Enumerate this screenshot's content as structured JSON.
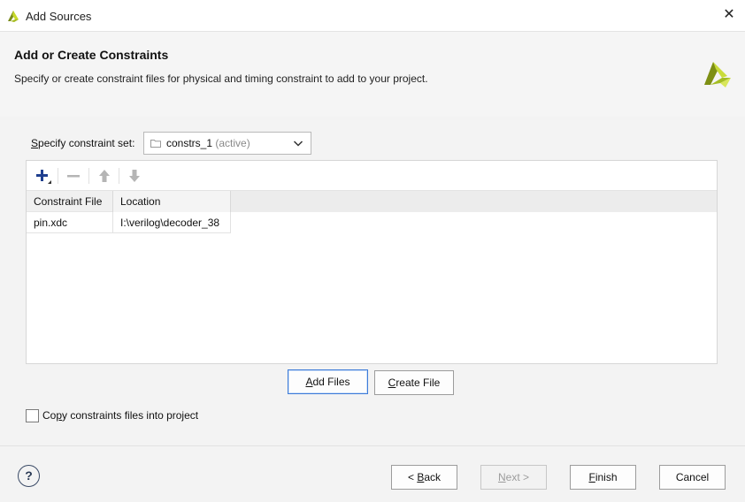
{
  "window": {
    "title": "Add Sources",
    "close_glyph": "✕"
  },
  "header": {
    "title": "Add or Create Constraints",
    "description": "Specify or create constraint files for physical and timing constraint to add to your project."
  },
  "constraint_set": {
    "label_access_key": "S",
    "label_rest": "pecify constraint set:",
    "selected_name": "constrs_1",
    "selected_status": "(active)"
  },
  "toolbar": {
    "add_icon": "plus-icon",
    "remove_icon": "minus-icon",
    "move_up_icon": "arrow-up-icon",
    "move_down_icon": "arrow-down-icon"
  },
  "table": {
    "columns": [
      "Constraint File",
      "Location"
    ],
    "rows": [
      {
        "file": "pin.xdc",
        "location": "I:\\verilog\\decoder_38"
      }
    ]
  },
  "buttons": {
    "add_files_key": "A",
    "add_files_rest": "dd Files",
    "create_file_key": "C",
    "create_file_rest": "reate File",
    "back_prefix": "< ",
    "back_key": "B",
    "back_rest": "ack",
    "next_key": "N",
    "next_rest": "ext >",
    "finish_key": "F",
    "finish_rest": "inish",
    "cancel": "Cancel",
    "help": "?"
  },
  "copy_option": {
    "label_pre": "Co",
    "label_key": "p",
    "label_post": "y constraints files into project",
    "checked": false
  },
  "colors": {
    "accent_border": "#3d7bd8",
    "logo_green": "#8fb516"
  }
}
